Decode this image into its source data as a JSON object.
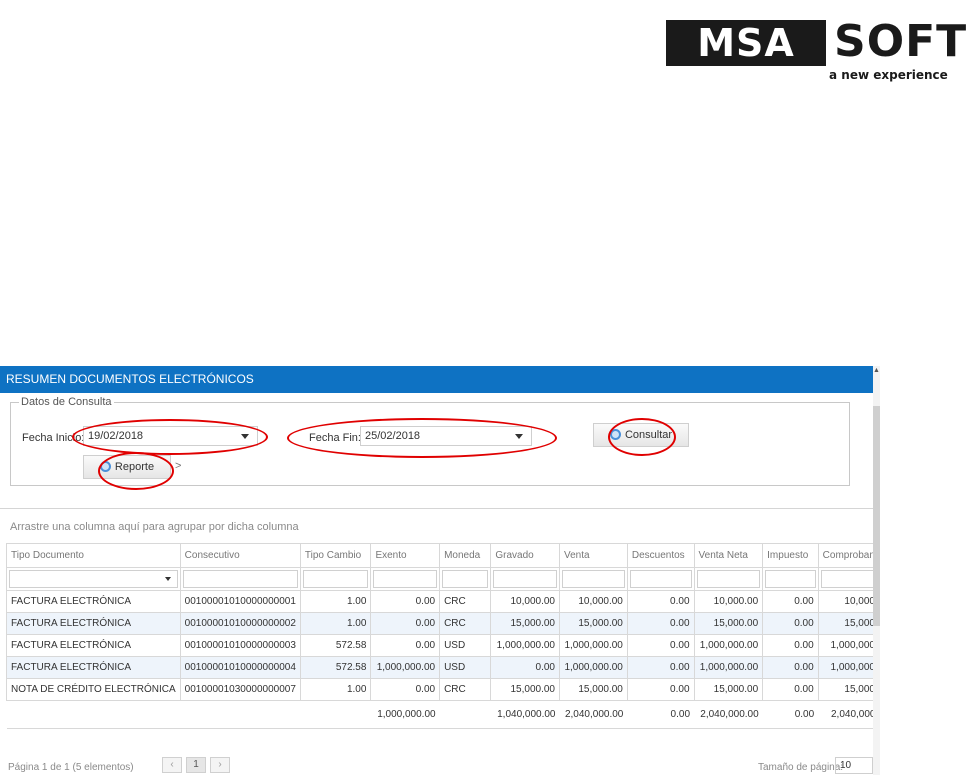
{
  "logo": {
    "left_text": "MSA",
    "right_text": "SOFT",
    "tagline": "a new experience"
  },
  "window": {
    "title": "RESUMEN DOCUMENTOS ELECTRÓNICOS",
    "legend": "Datos de Consulta",
    "fecha_inicio_label": "Fecha Inicio:*",
    "fecha_inicio_value": "19/02/2018",
    "fecha_fin_label": "Fecha Fin:*",
    "fecha_fin_value": "25/02/2018",
    "consultar_label": "Consultar",
    "reporte_label": "Reporte",
    "reporte_suffix": ">",
    "group_hint": "Arrastre una columna aquí para agrupar por dicha columna"
  },
  "grid": {
    "columns": [
      "Tipo Documento",
      "Consecutivo",
      "Tipo Cambio",
      "Exento",
      "Moneda",
      "Gravado",
      "Venta",
      "Descuentos",
      "Venta Neta",
      "Impuesto",
      "Comproban"
    ],
    "rows": [
      [
        "FACTURA ELECTRÓNICA",
        "00100001010000000001",
        "1.00",
        "0.00",
        "CRC",
        "10,000.00",
        "10,000.00",
        "0.00",
        "10,000.00",
        "0.00",
        "10,000"
      ],
      [
        "FACTURA ELECTRÓNICA",
        "00100001010000000002",
        "1.00",
        "0.00",
        "CRC",
        "15,000.00",
        "15,000.00",
        "0.00",
        "15,000.00",
        "0.00",
        "15,000"
      ],
      [
        "FACTURA ELECTRÓNICA",
        "00100001010000000003",
        "572.58",
        "0.00",
        "USD",
        "1,000,000.00",
        "1,000,000.00",
        "0.00",
        "1,000,000.00",
        "0.00",
        "1,000,000"
      ],
      [
        "FACTURA ELECTRÓNICA",
        "00100001010000000004",
        "572.58",
        "1,000,000.00",
        "USD",
        "0.00",
        "1,000,000.00",
        "0.00",
        "1,000,000.00",
        "0.00",
        "1,000,000"
      ],
      [
        "NOTA DE CRÉDITO ELECTRÓNICA",
        "00100001030000000007",
        "1.00",
        "0.00",
        "CRC",
        "15,000.00",
        "15,000.00",
        "0.00",
        "15,000.00",
        "0.00",
        "15,000"
      ]
    ],
    "totals": [
      "",
      "",
      "",
      "1,000,000.00",
      "",
      "1,040,000.00",
      "2,040,000.00",
      "0.00",
      "2,040,000.00",
      "0.00",
      "2,040,000"
    ]
  },
  "pager": {
    "info": "Página 1 de 1 (5 elementos)",
    "prev": "‹",
    "page": "1",
    "next": "›",
    "page_size_label": "Tamaño de página:",
    "page_size_value": "10"
  },
  "colors": {
    "titlebar": "#0e72c3",
    "annotation": "#e00000",
    "alt_row": "#eef4fb"
  }
}
